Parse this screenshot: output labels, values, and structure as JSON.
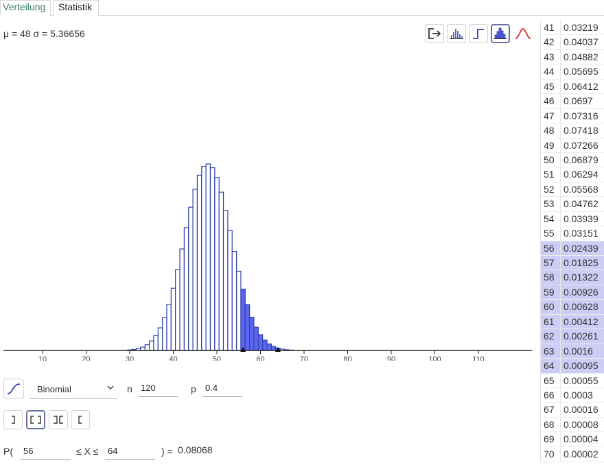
{
  "tabs": [
    {
      "label": "Verteilung",
      "active": true
    },
    {
      "label": "Statistik",
      "active": false
    }
  ],
  "stats": {
    "text": "μ = 48 σ = 5.36656"
  },
  "toolbar": {
    "buttons": [
      "export-icon",
      "bar-graph-icon",
      "step-graph-icon",
      "histogram-icon",
      "normal-curve-icon"
    ],
    "selected": "histogram-icon"
  },
  "distribution": {
    "type_label": "Binomial",
    "n_label": "n",
    "n_value": "120",
    "p_label": "p",
    "p_value": "0.4"
  },
  "interval_buttons": [
    "left-sided",
    "two-sided",
    "interval-outside",
    "right-sided"
  ],
  "interval_selected": "two-sided",
  "probability": {
    "prefix": "P(",
    "lower": "56",
    "middle": "≤ X ≤",
    "upper": "64",
    "suffix": ") =",
    "result": "0.08068"
  },
  "table": [
    {
      "k": "41",
      "v": "0.03219"
    },
    {
      "k": "42",
      "v": "0.04037"
    },
    {
      "k": "43",
      "v": "0.04882"
    },
    {
      "k": "44",
      "v": "0.05695"
    },
    {
      "k": "45",
      "v": "0.06412"
    },
    {
      "k": "46",
      "v": "0.0697"
    },
    {
      "k": "47",
      "v": "0.07316"
    },
    {
      "k": "48",
      "v": "0.07418"
    },
    {
      "k": "49",
      "v": "0.07266"
    },
    {
      "k": "50",
      "v": "0.06879"
    },
    {
      "k": "51",
      "v": "0.06294"
    },
    {
      "k": "52",
      "v": "0.05568"
    },
    {
      "k": "53",
      "v": "0.04762"
    },
    {
      "k": "54",
      "v": "0.03939"
    },
    {
      "k": "55",
      "v": "0.03151"
    },
    {
      "k": "56",
      "v": "0.02439"
    },
    {
      "k": "57",
      "v": "0.01825"
    },
    {
      "k": "58",
      "v": "0.01322"
    },
    {
      "k": "59",
      "v": "0.00926"
    },
    {
      "k": "60",
      "v": "0.00628"
    },
    {
      "k": "61",
      "v": "0.00412"
    },
    {
      "k": "62",
      "v": "0.00261"
    },
    {
      "k": "63",
      "v": "0.0016"
    },
    {
      "k": "64",
      "v": "0.00095"
    },
    {
      "k": "65",
      "v": "0.00055"
    },
    {
      "k": "66",
      "v": "0.0003"
    },
    {
      "k": "67",
      "v": "0.00016"
    },
    {
      "k": "68",
      "v": "0.00008"
    },
    {
      "k": "69",
      "v": "0.00004"
    },
    {
      "k": "70",
      "v": "0.00002"
    }
  ],
  "table_highlight_range": [
    56,
    64
  ],
  "colors": {
    "bar_outline": "#3344aa",
    "bar_fill_selected": "#5c66f0",
    "row_highlight": "#ccccf5",
    "tab_active": "#3a7d5c",
    "curve_red": "#d9322b"
  },
  "chart_data": {
    "type": "bar",
    "distribution": "binomial",
    "n": 120,
    "p": 0.4,
    "xlim": [
      0,
      120
    ],
    "x_ticks": [
      10,
      20,
      30,
      40,
      50,
      60,
      70,
      80,
      90,
      100,
      110
    ],
    "highlight_range": [
      56,
      64
    ],
    "markers": [
      56,
      64
    ],
    "title": "",
    "xlabel": "",
    "ylabel": ""
  }
}
